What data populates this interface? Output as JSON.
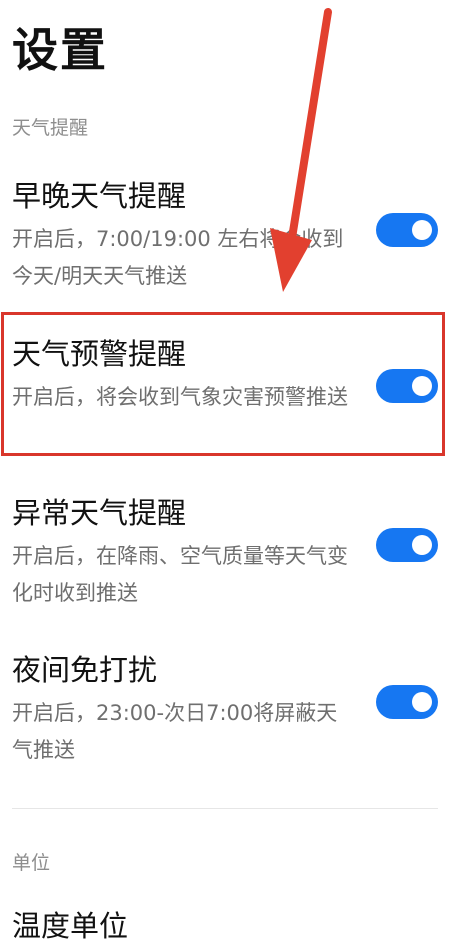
{
  "page": {
    "title": "设置"
  },
  "sections": [
    {
      "header": "天气提醒",
      "items": [
        {
          "title": "早晚天气提醒",
          "desc": "开启后，7:00/19:00 左右将会收到今天/明天天气推送",
          "toggle": "on"
        },
        {
          "title": "天气预警提醒",
          "desc": "开启后，将会收到气象灾害预警推送",
          "toggle": "on"
        },
        {
          "title": "异常天气提醒",
          "desc": "开启后，在降雨、空气质量等天气变化时收到推送",
          "toggle": "on"
        },
        {
          "title": "夜间免打扰",
          "desc": "开启后，23:00-次日7:00将屏蔽天气推送",
          "toggle": "on"
        }
      ]
    },
    {
      "header": "单位",
      "items": [
        {
          "title": "温度单位"
        }
      ]
    }
  ],
  "colors": {
    "toggle_on": "#1677f2",
    "annotation": "#d9362b"
  }
}
